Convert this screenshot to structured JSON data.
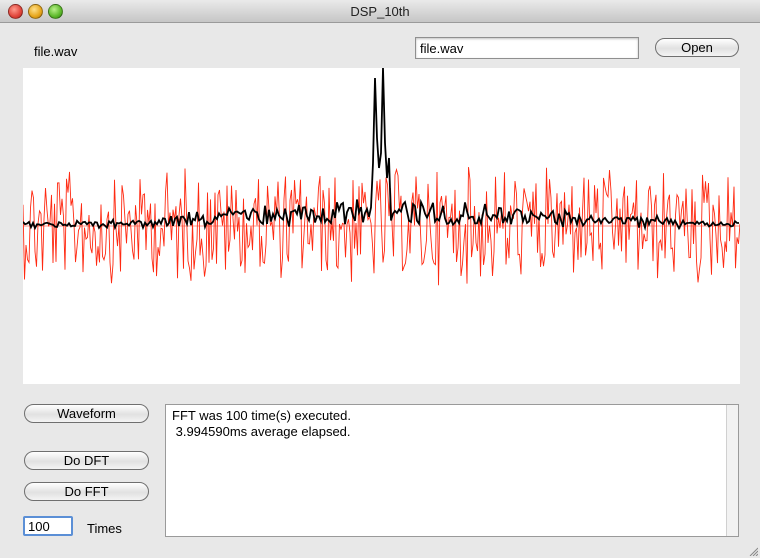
{
  "window": {
    "title": "DSP_10th"
  },
  "file": {
    "label": "file.wav",
    "path_value": "file.wav",
    "open_label": "Open"
  },
  "buttons": {
    "waveform": "Waveform",
    "dft": "Do DFT",
    "fft": "Do FFT"
  },
  "log": {
    "lines": [
      "FFT was 100 time(s) executed.",
      " 3.994590ms average elapsed."
    ]
  },
  "times": {
    "value": "100",
    "label": "Times"
  },
  "plot": {
    "colors": {
      "waveform": "#ff2a12",
      "spectrum": "#000000",
      "baseline": "#ff2a12"
    },
    "description_series": [
      "waveform",
      "spectrum"
    ]
  }
}
